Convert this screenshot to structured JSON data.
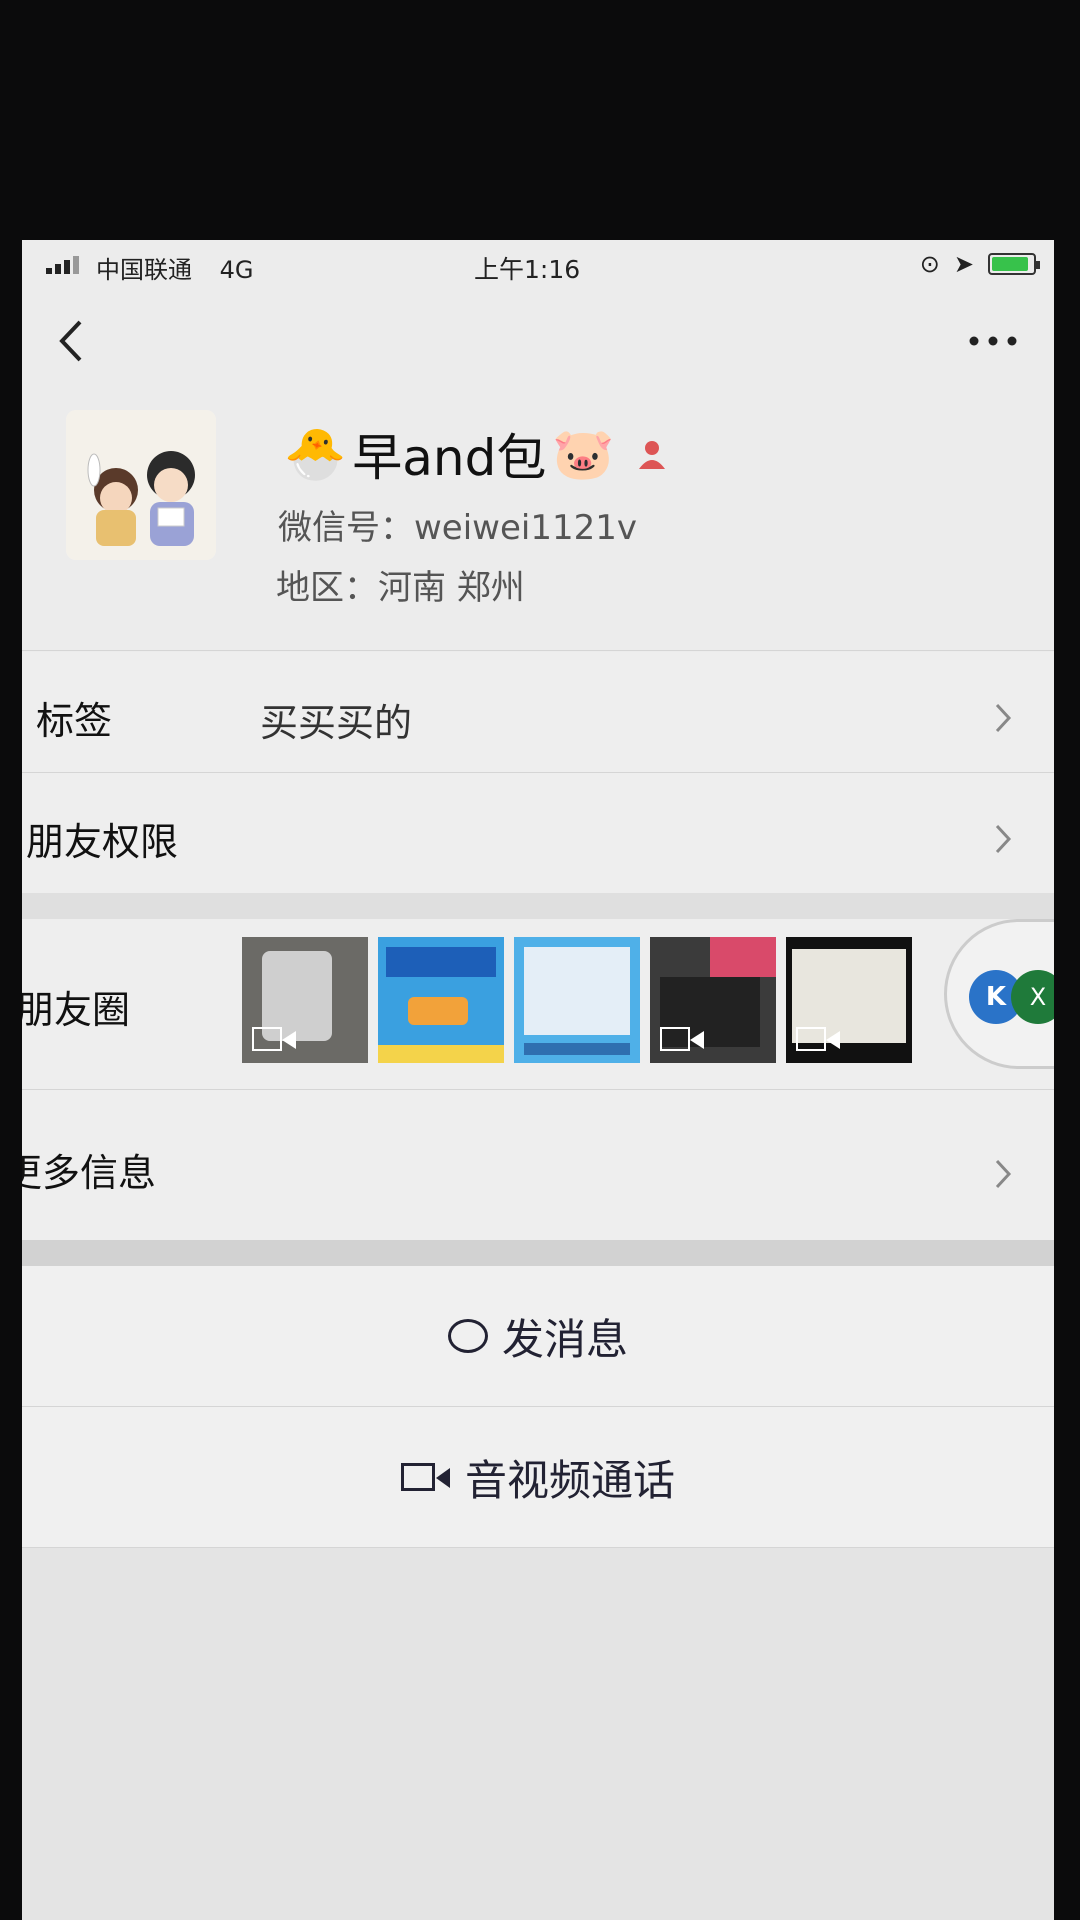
{
  "status_bar": {
    "carrier": "中国联通",
    "network": "4G",
    "time": "上午1:16"
  },
  "header": {
    "back_icon": "chevron-left-icon",
    "more_icon": "more-dots-icon"
  },
  "profile": {
    "nickname_prefix_emoji": "🐣",
    "nickname": "早and包",
    "nickname_suffix_emoji": "🐷",
    "gender_icon": "person-icon",
    "wechat_id_label": "微信号：",
    "wechat_id": "weiwei1121v",
    "region_label": "地区：",
    "region": "河南 郑州"
  },
  "rows": {
    "tags_label": "标签",
    "tags_value": "买买买的",
    "permissions_label": "朋友权限",
    "moments_label": "朋友圈",
    "more_info_label": "更多信息"
  },
  "floating": {
    "k_icon": "K",
    "x_icon": "X"
  },
  "actions": {
    "send_message": "发消息",
    "video_call": "音视频通话"
  },
  "colors": {
    "background": "#ececec",
    "text": "#111111",
    "accent_green": "#37c24b"
  }
}
